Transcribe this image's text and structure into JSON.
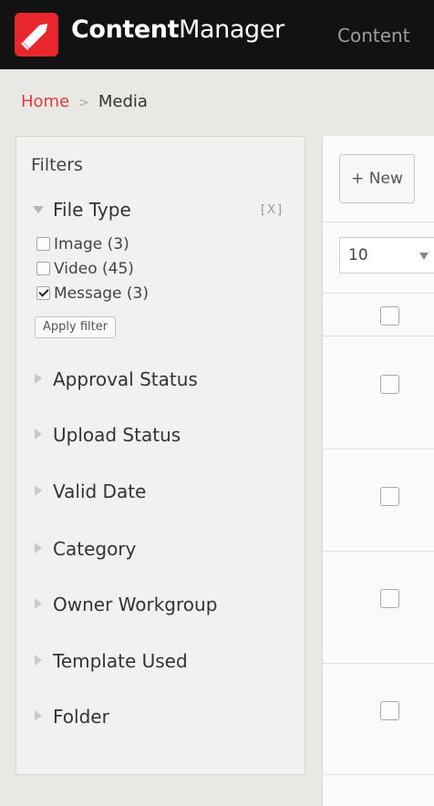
{
  "header": {
    "brand_bold": "Content",
    "brand_light": "Manager",
    "nav_item": "Content",
    "logo_color": "#e8262b"
  },
  "breadcrumb": {
    "home": "Home",
    "separator": ">",
    "current": "Media"
  },
  "filters": {
    "title": "Filters",
    "file_type": {
      "label": "File Type",
      "clear": "[X]",
      "options": [
        {
          "label": "Image (3)",
          "checked": false
        },
        {
          "label": "Video (45)",
          "checked": false
        },
        {
          "label": "Message (3)",
          "checked": true
        }
      ],
      "apply_label": "Apply filter"
    },
    "groups": [
      "Approval Status",
      "Upload Status",
      "Valid Date",
      "Category",
      "Owner Workgroup",
      "Template Used",
      "Folder"
    ]
  },
  "main": {
    "new_label": "+ New",
    "page_size": "10"
  }
}
